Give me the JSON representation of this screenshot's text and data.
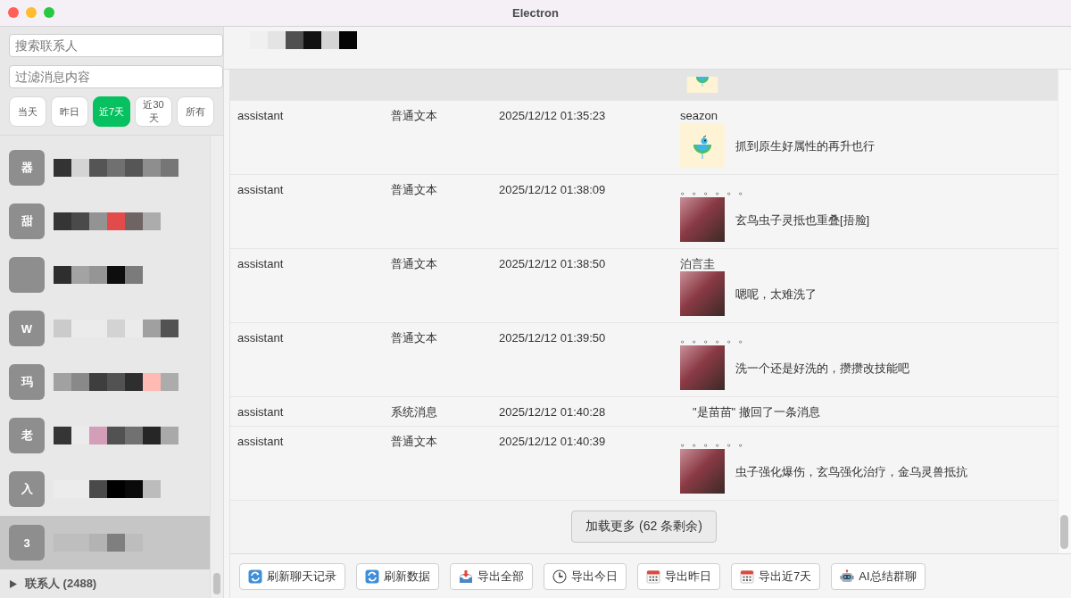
{
  "window": {
    "title": "Electron"
  },
  "sidebar": {
    "search": {
      "placeholder": "搜索联系人"
    },
    "filter": {
      "placeholder": "过滤消息内容"
    },
    "ranges": [
      {
        "label": "当天",
        "selected": false
      },
      {
        "label": "昨日",
        "selected": false
      },
      {
        "label": "近7天",
        "selected": true
      },
      {
        "label": "近30天",
        "selected": false
      },
      {
        "label": "所有",
        "selected": false
      }
    ],
    "contacts": [
      {
        "avatar": "器",
        "selected": false
      },
      {
        "avatar": "甜",
        "selected": false
      },
      {
        "selected": false
      },
      {
        "avatar": "W",
        "selected": false
      },
      {
        "avatar": "玛",
        "selected": false
      },
      {
        "avatar": "老",
        "selected": false
      },
      {
        "avatar": "入",
        "selected": false
      },
      {
        "avatar": "3",
        "selected": true
      }
    ],
    "contacts_group": {
      "label": "联系人 (2488)",
      "expanded": false
    }
  },
  "chat": {
    "messages": [
      {
        "kind": "clipped_sticker",
        "highlighted": true
      },
      {
        "kind": "sticker",
        "highlighted": false,
        "role": "assistant",
        "type": "普通文本",
        "time": "2025/12/12 01:35:23",
        "sender": "seazon",
        "text": "抓到原生好属性的再升也行"
      },
      {
        "kind": "photo",
        "highlighted": false,
        "role": "assistant",
        "type": "普通文本",
        "time": "2025/12/12 01:38:09",
        "sender": "。。。。。。",
        "text": "玄鸟虫子灵抵也重叠[捂脸]"
      },
      {
        "kind": "photo",
        "highlighted": false,
        "role": "assistant",
        "type": "普通文本",
        "time": "2025/12/12 01:38:50",
        "sender": "泊言圭",
        "text": "嗯呢，太难洗了"
      },
      {
        "kind": "photo",
        "highlighted": false,
        "role": "assistant",
        "type": "普通文本",
        "time": "2025/12/12 01:39:50",
        "sender": "。。。。。。",
        "text": "洗一个还是好洗的，攒攒改技能吧"
      },
      {
        "kind": "system",
        "highlighted": false,
        "role": "assistant",
        "type": "系统消息",
        "time": "2025/12/12 01:40:28",
        "text": "\"是苗苗\" 撤回了一条消息"
      },
      {
        "kind": "photo",
        "highlighted": false,
        "role": "assistant",
        "type": "普通文本",
        "time": "2025/12/12 01:40:39",
        "sender": "。。。。。。",
        "text": "虫子强化爆伤，玄鸟强化治疗，金乌灵兽抵抗"
      }
    ],
    "load_more": "加载更多 (62 条剩余)"
  },
  "toolbar": [
    {
      "kind": "refresh",
      "label": "刷新聊天记录"
    },
    {
      "kind": "refresh",
      "label": "刷新数据"
    },
    {
      "kind": "export",
      "label": "导出全部"
    },
    {
      "kind": "clock",
      "label": "导出今日"
    },
    {
      "kind": "calendar",
      "label": "导出昨日"
    },
    {
      "kind": "calendar",
      "label": "导出近7天"
    },
    {
      "kind": "robot",
      "label": "AI总结群聊"
    }
  ]
}
